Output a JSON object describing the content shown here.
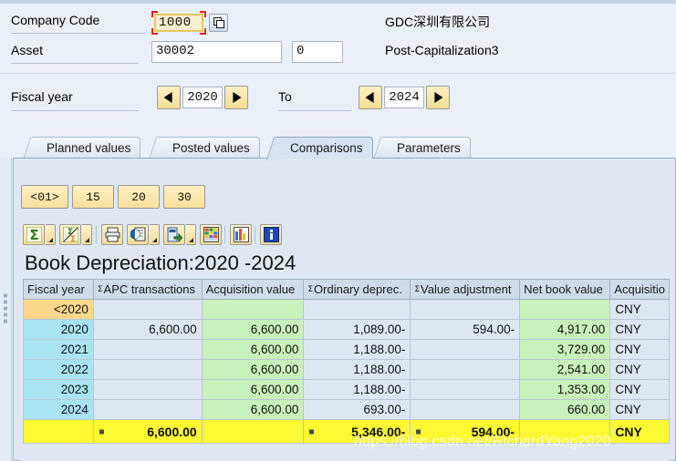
{
  "selection": {
    "company_code": {
      "label": "Company Code",
      "value": "1000",
      "description": "GDC深圳有限公司",
      "matchcode_icon": "multiple-selection-icon"
    },
    "asset": {
      "label": "Asset",
      "value": "30002",
      "subnumber": "0",
      "description": "Post-Capitalization3"
    },
    "fiscal_year": {
      "label": "Fiscal year",
      "from": "2020",
      "to_label": "To",
      "to": "2024"
    }
  },
  "tabs": [
    {
      "label": "Planned values",
      "active": false
    },
    {
      "label": "Posted values",
      "active": false
    },
    {
      "label": "Comparisons",
      "active": true
    },
    {
      "label": "Parameters",
      "active": false
    }
  ],
  "depreciation_area_buttons": [
    "<01>",
    "15",
    "20",
    "30"
  ],
  "alv_toolbar": [
    {
      "name": "total-sum-icon",
      "label": "Σ",
      "has_dropdown": true
    },
    {
      "name": "subtotal-icon",
      "label": "Σ",
      "has_dropdown": true
    },
    {
      "name": "print-icon",
      "label": "Print",
      "has_dropdown": false
    },
    {
      "name": "print-preview-icon",
      "label": "Print preview",
      "has_dropdown": true
    },
    {
      "name": "export-icon",
      "label": "Export",
      "has_dropdown": true
    },
    {
      "name": "layout-icon",
      "label": "Choose layout",
      "has_dropdown": false
    },
    {
      "name": "graphic-icon",
      "label": "Graphic",
      "has_dropdown": false
    },
    {
      "name": "info-icon",
      "label": "Info",
      "has_dropdown": false
    }
  ],
  "report": {
    "title": "Book Depreciation:2020 -2024",
    "columns": [
      {
        "label": "Fiscal year",
        "sigma": false
      },
      {
        "label": "APC transactions",
        "sigma": true
      },
      {
        "label": "Acquisition value",
        "sigma": false
      },
      {
        "label": "Ordinary deprec.",
        "sigma": true
      },
      {
        "label": "Value adjustment",
        "sigma": true
      },
      {
        "label": "Net book value",
        "sigma": false
      },
      {
        "label": "Acquisitio",
        "sigma": false
      }
    ],
    "rows": [
      {
        "fiscal_year": "<2020",
        "apc_transactions": "",
        "acquisition_value": "",
        "ordinary_deprec": "",
        "value_adjustment": "",
        "net_book_value": "",
        "currency": "CNY",
        "prior": true
      },
      {
        "fiscal_year": "2020",
        "apc_transactions": "6,600.00",
        "acquisition_value": "6,600.00",
        "ordinary_deprec": "1,089.00-",
        "value_adjustment": "594.00-",
        "net_book_value": "4,917.00",
        "currency": "CNY",
        "prior": false
      },
      {
        "fiscal_year": "2021",
        "apc_transactions": "",
        "acquisition_value": "6,600.00",
        "ordinary_deprec": "1,188.00-",
        "value_adjustment": "",
        "net_book_value": "3,729.00",
        "currency": "CNY",
        "prior": false
      },
      {
        "fiscal_year": "2022",
        "apc_transactions": "",
        "acquisition_value": "6,600.00",
        "ordinary_deprec": "1,188.00-",
        "value_adjustment": "",
        "net_book_value": "2,541.00",
        "currency": "CNY",
        "prior": false
      },
      {
        "fiscal_year": "2023",
        "apc_transactions": "",
        "acquisition_value": "6,600.00",
        "ordinary_deprec": "1,188.00-",
        "value_adjustment": "",
        "net_book_value": "1,353.00",
        "currency": "CNY",
        "prior": false
      },
      {
        "fiscal_year": "2024",
        "apc_transactions": "",
        "acquisition_value": "6,600.00",
        "ordinary_deprec": "693.00-",
        "value_adjustment": "",
        "net_book_value": "660.00",
        "currency": "CNY",
        "prior": false
      }
    ],
    "total": {
      "fiscal_year": "",
      "apc_transactions": "6,600.00",
      "acquisition_value": "",
      "ordinary_deprec": "5,346.00-",
      "value_adjustment": "594.00-",
      "net_book_value": "",
      "currency": "CNY"
    }
  },
  "watermark": "https://blog.csdn.net/RichardYang2020",
  "colors": {
    "background": "#eaf0f7",
    "header_cell": "#cfdbe8",
    "year_cell": "#a8e4f2",
    "prior_year_cell": "#fcd88c",
    "green_cell": "#c9f1bb",
    "plain_cell": "#dde7f1",
    "total_row": "#fcf832",
    "button_yellow": "#f7e09c",
    "focus_red": "#e1241b"
  }
}
